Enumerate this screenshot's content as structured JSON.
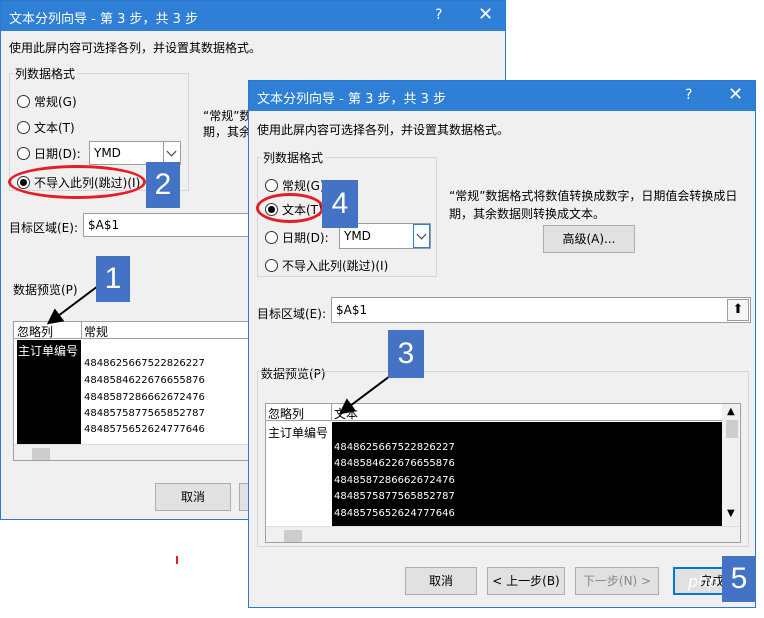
{
  "back_dialog": {
    "title": "文本分列向导 - 第 3 步，共 3 步",
    "help": "?",
    "close": "✕",
    "instruction": "使用此屏内容可选择各列，并设置其数据格式。",
    "group_title": "列数据格式",
    "radios": [
      "常规(G)",
      "文本(T)",
      "日期(D):",
      "不导入此列(跳过)(I)"
    ],
    "date_value": "YMD",
    "desc_fragment_1": "“常规”数据",
    "desc_fragment_2": "期，其余数",
    "target_label": "目标区域(E):",
    "target_value": "$A$1",
    "preview_label": "数据预览(P)",
    "preview_headers": [
      "忽略列",
      "常规"
    ],
    "preview_first": "主订单编号",
    "preview_values": [
      "4848625667522826227",
      "4848584622676655876",
      "4848587286662672476",
      "4848575877565852787",
      "4848575652624777646"
    ],
    "cancel": "取消"
  },
  "front_dialog": {
    "title": "文本分列向导 - 第 3 步，共 3 步",
    "help": "?",
    "close": "✕",
    "instruction": "使用此屏内容可选择各列，并设置其数据格式。",
    "group_title": "列数据格式",
    "radios": [
      "常规(G)",
      "文本(T)",
      "日期(D):",
      "不导入此列(跳过)(I)"
    ],
    "selected_radio": "文本(T)",
    "date_value": "YMD",
    "desc_line1": "“常规”数据格式将数值转换成数字，日期值会转换成日",
    "desc_line2": "期，其余数据则转换成文本。",
    "advanced": "高级(A)...",
    "target_label": "目标区域(E):",
    "target_value": "$A$1",
    "preview_label": "数据预览(P)",
    "preview_headers": [
      "忽略列",
      "文本"
    ],
    "preview_first": "主订单编号",
    "preview_values": [
      "4848625667522826227",
      "4848584622676655876",
      "4848587286662672476",
      "4848575877565852787",
      "4848575652624777646"
    ],
    "buttons": {
      "cancel": "取消",
      "prev": "< 上一步(B)",
      "next": "下一步(N) >",
      "finish": "完成"
    }
  },
  "badges": [
    "1",
    "2",
    "3",
    "4",
    "5"
  ],
  "watermark": "php",
  "colors": {
    "title_bar": "#2f7fd6",
    "badge": "#4472c4",
    "highlight": "#e31e24"
  }
}
